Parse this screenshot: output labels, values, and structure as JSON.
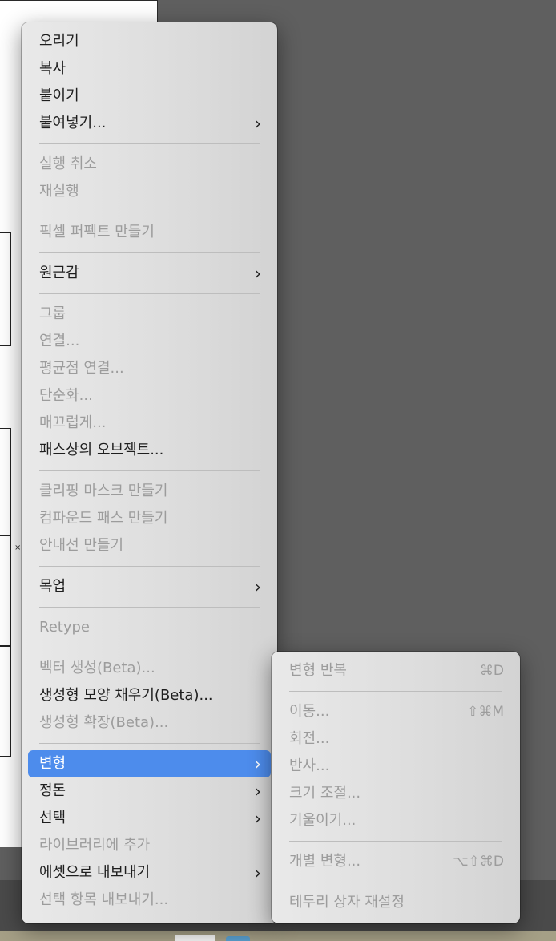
{
  "context_menu": {
    "groups": [
      [
        {
          "label": "오리기",
          "disabled": false,
          "submenu": false
        },
        {
          "label": "복사",
          "disabled": false,
          "submenu": false
        },
        {
          "label": "붙이기",
          "disabled": false,
          "submenu": false
        },
        {
          "label": "붙여넣기...",
          "disabled": false,
          "submenu": true
        }
      ],
      [
        {
          "label": "실행 취소",
          "disabled": true,
          "submenu": false
        },
        {
          "label": "재실행",
          "disabled": true,
          "submenu": false
        }
      ],
      [
        {
          "label": "픽셀 퍼펙트 만들기",
          "disabled": true,
          "submenu": false
        }
      ],
      [
        {
          "label": "원근감",
          "disabled": false,
          "submenu": true
        }
      ],
      [
        {
          "label": "그룹",
          "disabled": true,
          "submenu": false
        },
        {
          "label": "연결...",
          "disabled": true,
          "submenu": false
        },
        {
          "label": "평균점 연결...",
          "disabled": true,
          "submenu": false
        },
        {
          "label": "단순화...",
          "disabled": true,
          "submenu": false
        },
        {
          "label": "매끄럽게...",
          "disabled": true,
          "submenu": false
        },
        {
          "label": "패스상의 오브젝트...",
          "disabled": false,
          "submenu": false
        }
      ],
      [
        {
          "label": "클리핑 마스크 만들기",
          "disabled": true,
          "submenu": false
        },
        {
          "label": "컴파운드 패스 만들기",
          "disabled": true,
          "submenu": false
        },
        {
          "label": "안내선 만들기",
          "disabled": true,
          "submenu": false
        }
      ],
      [
        {
          "label": "목업",
          "disabled": false,
          "submenu": true
        }
      ],
      [
        {
          "label": "Retype",
          "disabled": true,
          "submenu": false
        }
      ],
      [
        {
          "label": "벡터 생성(Beta)...",
          "disabled": true,
          "submenu": false
        },
        {
          "label": "생성형 모양 채우기(Beta)...",
          "disabled": false,
          "submenu": false
        },
        {
          "label": "생성형 확장(Beta)...",
          "disabled": true,
          "submenu": false
        }
      ],
      [
        {
          "label": "변형",
          "disabled": false,
          "submenu": true,
          "highlighted": true
        },
        {
          "label": "정돈",
          "disabled": false,
          "submenu": true
        },
        {
          "label": "선택",
          "disabled": false,
          "submenu": true
        },
        {
          "label": "라이브러리에 추가",
          "disabled": true,
          "submenu": false
        },
        {
          "label": "에셋으로 내보내기",
          "disabled": false,
          "submenu": true
        },
        {
          "label": "선택 항목 내보내기...",
          "disabled": true,
          "submenu": false
        }
      ]
    ],
    "submenu_arrow": "›"
  },
  "transform_submenu": {
    "groups": [
      [
        {
          "label": "변형 반복",
          "shortcut": "⌘D",
          "disabled": true
        }
      ],
      [
        {
          "label": "이동...",
          "shortcut": "⇧⌘M",
          "disabled": true
        },
        {
          "label": "회전...",
          "shortcut": "",
          "disabled": true
        },
        {
          "label": "반사...",
          "shortcut": "",
          "disabled": true
        },
        {
          "label": "크기 조절...",
          "shortcut": "",
          "disabled": true
        },
        {
          "label": "기울이기...",
          "shortcut": "",
          "disabled": true
        }
      ],
      [
        {
          "label": "개별 변형...",
          "shortcut": "⌥⇧⌘D",
          "disabled": true
        }
      ],
      [
        {
          "label": "테두리 상자 재설정",
          "shortcut": "",
          "disabled": true
        }
      ]
    ]
  },
  "colors": {
    "highlight": "#4d8cec",
    "disabled_text": "#9c9c9c",
    "text": "#1e1e1e",
    "background": "#5f5f5f"
  }
}
